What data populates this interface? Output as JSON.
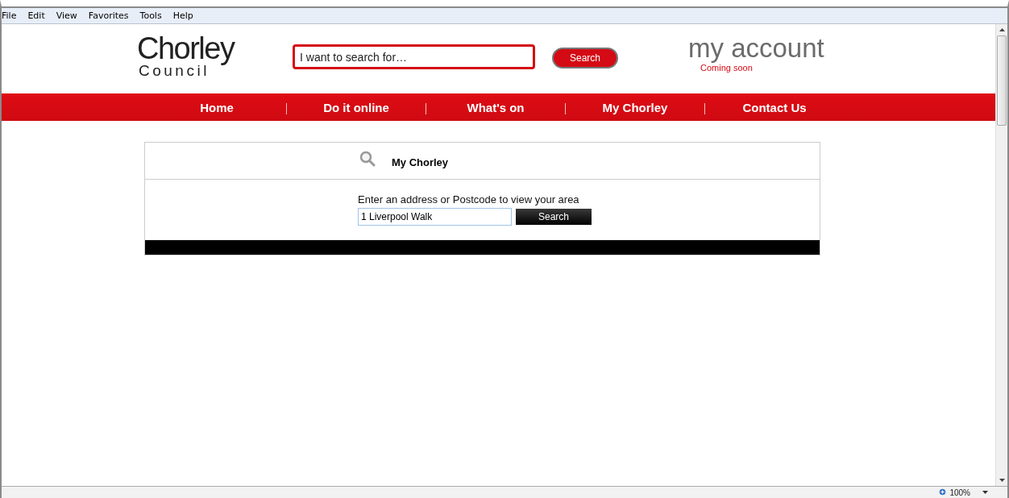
{
  "menu_bar": [
    "File",
    "Edit",
    "View",
    "Favorites",
    "Tools",
    "Help"
  ],
  "header": {
    "logo": {
      "line1": "Chorley",
      "line2": "Council"
    },
    "search": {
      "value": "I want to search for…"
    },
    "search_button": "Search",
    "account": {
      "title": "my account",
      "note": "Coming soon"
    }
  },
  "nav": [
    "Home",
    "Do it online",
    "What's on",
    "My Chorley",
    "Contact Us"
  ],
  "panel": {
    "title": "My Chorley",
    "prompt": "Enter an address or Postcode to view your area",
    "field": {
      "value": "1 Liverpool Walk"
    },
    "button": "Search"
  },
  "status_bar": {
    "zoom": "100%"
  }
}
